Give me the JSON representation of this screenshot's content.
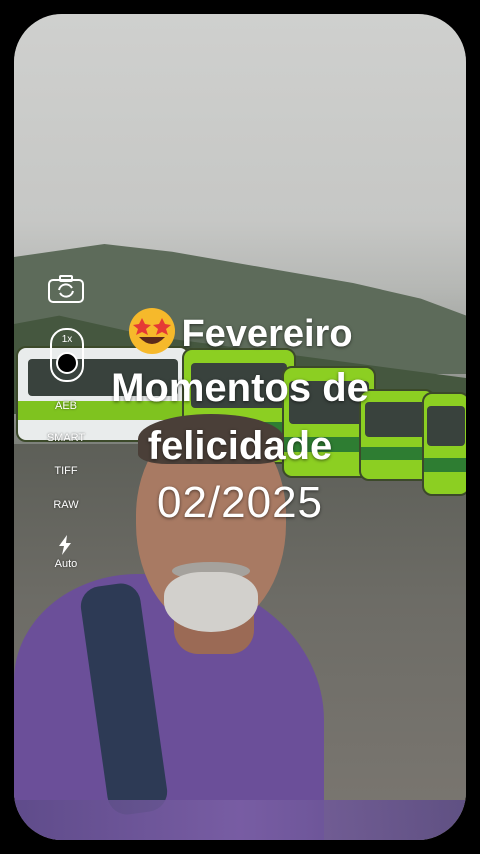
{
  "camera_controls": {
    "flip_icon": "camera-flip-icon",
    "zoom_label": "1x",
    "aeb_label": "AEB",
    "smart_label": "SMART",
    "tiff_label": "TIFF",
    "raw_label": "RAW",
    "flash_icon": "flash-bolt-icon",
    "flash_label": "Auto"
  },
  "overlay_text": {
    "emoji_icon": "star-struck-emoji",
    "line1": "Fevereiro",
    "line2": "Momentos de",
    "line3": "felicidade",
    "date": "02/2025"
  },
  "colors": {
    "background": "#000000",
    "text": "#ffffff",
    "bus_green": "#8ccf22",
    "shirt_purple": "#6b4f99"
  }
}
